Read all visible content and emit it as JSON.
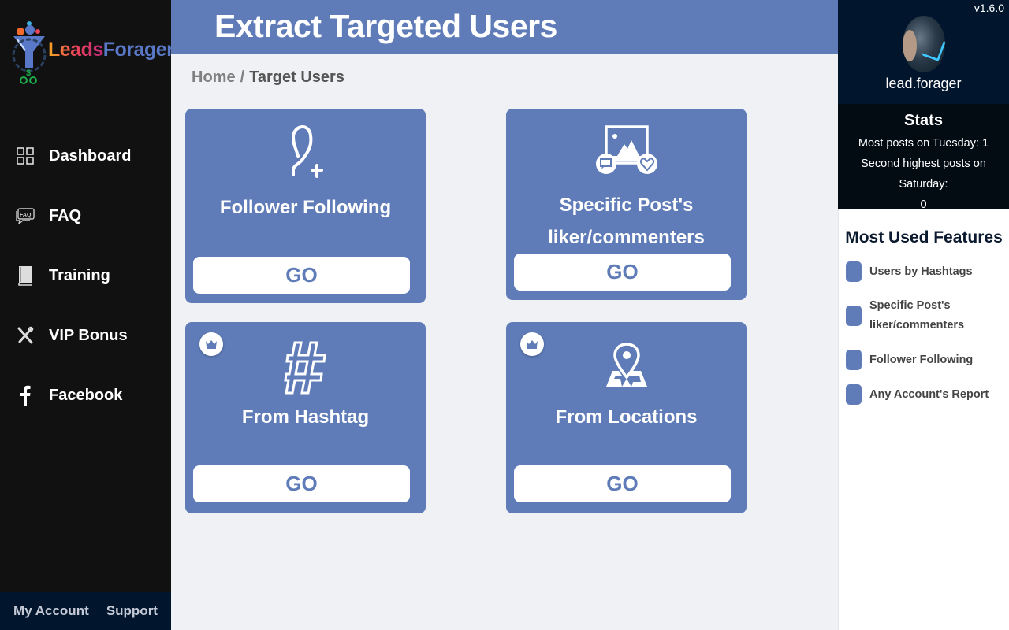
{
  "app": {
    "logo_part1": "Leads",
    "logo_part2": "Forager",
    "version": "v1.6.0"
  },
  "sidebar": {
    "items": [
      {
        "label": "Dashboard",
        "icon": "grid-icon"
      },
      {
        "label": "FAQ",
        "icon": "faq-chat-icon"
      },
      {
        "label": "Training",
        "icon": "book-icon"
      },
      {
        "label": "VIP Bonus",
        "icon": "tools-icon"
      },
      {
        "label": "Facebook",
        "icon": "facebook-icon"
      }
    ],
    "footer": {
      "my_account": "My Account",
      "support": "Support"
    }
  },
  "header": {
    "title": "Extract Targeted Users"
  },
  "breadcrumb": {
    "home": "Home",
    "separator": "/",
    "current": "Target Users"
  },
  "cards": [
    {
      "title": "Follower Following",
      "icon": "user-plus-icon",
      "premium": false,
      "button": "GO"
    },
    {
      "title_line1": "Specific Post's",
      "title_line2": "liker/commenters",
      "icon": "image-like-comment-icon",
      "premium": false,
      "button": "GO"
    },
    {
      "title": "From Hashtag",
      "icon": "hashtag-icon",
      "premium": true,
      "button": "GO"
    },
    {
      "title": "From Locations",
      "icon": "map-pin-icon",
      "premium": true,
      "button": "GO"
    }
  ],
  "profile": {
    "username": "lead.forager"
  },
  "stats": {
    "title": "Stats",
    "line1": "Most posts on Tuesday: 1",
    "line2": "Second highest posts on Saturday:",
    "line3": "0"
  },
  "most_used": {
    "title": "Most Used Features",
    "items": [
      {
        "label_line1": "Users by Hashtags"
      },
      {
        "label_line1": "Specific Post's",
        "label_line2": "liker/commenters"
      },
      {
        "label_line1": "Follower Following"
      },
      {
        "label_line1": "Any Account's Report"
      }
    ]
  },
  "colors": {
    "accent": "#5f7cb8",
    "sidebar_bg": "#111111",
    "footer_bg": "#01152d",
    "content_bg": "#f0f1f5"
  }
}
